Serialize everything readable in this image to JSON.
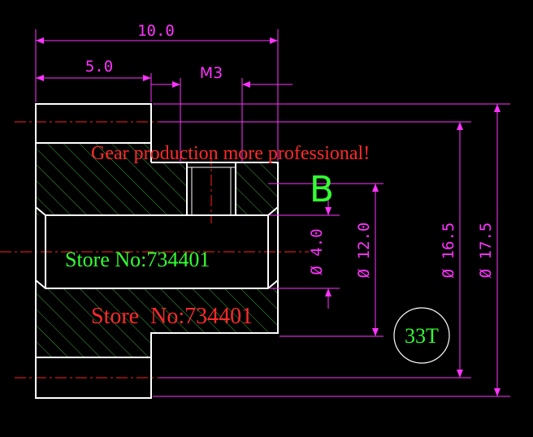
{
  "colors": {
    "background": "#000000",
    "outline": "#ffffff",
    "dimension": "#ff33ff",
    "hatch": "#3ea83e",
    "centerline": "#ff2020",
    "watermark_red": "#ff2a2a",
    "watermark_green": "#33ff33"
  },
  "dimensions": {
    "overall_length": "10.0",
    "hub_length": "5.0",
    "thread": "M3",
    "bore_diameter": "Ø 4.0",
    "hub_diameter": "Ø 12.0",
    "root_diameter": "Ø 16.5",
    "outer_diameter": "Ø 17.5"
  },
  "labels": {
    "slogan": "Gear production more professional!",
    "store_green": "Store No:734401",
    "store_red": "Store  No:734401",
    "variant": "B",
    "teeth": "33T"
  }
}
